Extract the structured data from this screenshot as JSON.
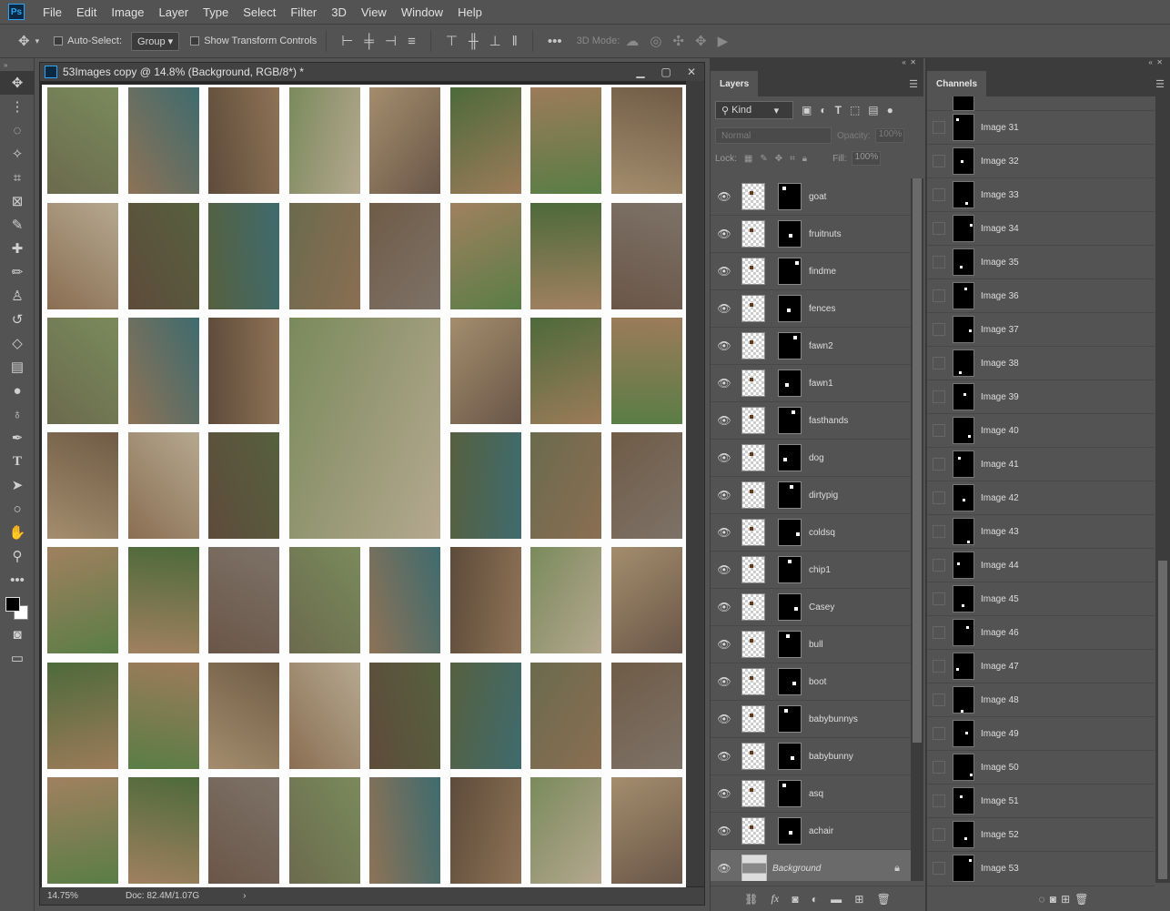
{
  "app": {
    "logo": "Ps"
  },
  "menu": [
    "File",
    "Edit",
    "Image",
    "Layer",
    "Type",
    "Select",
    "Filter",
    "3D",
    "View",
    "Window",
    "Help"
  ],
  "options": {
    "auto_select_label": "Auto-Select:",
    "auto_select_value": "Group",
    "show_transform_label": "Show Transform Controls",
    "mode_3d_label": "3D Mode:"
  },
  "document": {
    "title": "53Images copy  @ 14.8% (Background, RGB/8*) *",
    "zoom": "14.75%",
    "doc_size": "Doc: 82.4M/1.07G"
  },
  "icons": {
    "minimize": "minimize-icon",
    "maximize": "maximize-icon",
    "close": "close-icon",
    "eye": "eye-icon",
    "lock": "lock-icon",
    "panel_menu": "menu-icon"
  },
  "layers_panel": {
    "tab": "Layers",
    "kind_label": "Kind",
    "blend_mode": "Normal",
    "opacity_label": "Opacity:",
    "opacity_value": "100%",
    "lock_label": "Lock:",
    "fill_label": "Fill:",
    "fill_value": "100%",
    "layers": [
      "goat",
      "fruitnuts",
      "findme",
      "fences",
      "fawn2",
      "fawn1",
      "fasthands",
      "dog",
      "dirtypig",
      "coldsq",
      "chip1",
      "Casey",
      "bull",
      "boot",
      "babybunnys",
      "babybunny",
      "asq",
      "achair"
    ],
    "background_layer": "Background"
  },
  "channels_panel": {
    "tab": "Channels",
    "channels": [
      "Image 31",
      "Image 32",
      "Image 33",
      "Image 34",
      "Image 35",
      "Image 36",
      "Image 37",
      "Image 38",
      "Image 39",
      "Image 40",
      "Image 41",
      "Image 42",
      "Image 43",
      "Image 44",
      "Image 45",
      "Image 46",
      "Image 47",
      "Image 48",
      "Image 49",
      "Image 50",
      "Image 51",
      "Image 52",
      "Image 53"
    ]
  }
}
